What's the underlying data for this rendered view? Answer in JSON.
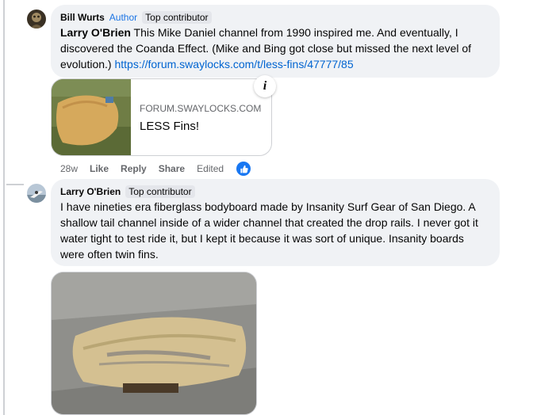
{
  "comment1": {
    "author_name": "Bill Wurts",
    "author_badge": "Author",
    "contributor_badge": "Top contributor",
    "mention": "Larry O'Brien",
    "body": " This Mike Daniel channel from 1990 inspired me. And eventually, I discovered the Coanda Effect. (Mike and Bing got close but missed the next level of evolution.) ",
    "link_text": "https://forum.swaylocks.com/t/less-fins/47777/85",
    "preview": {
      "domain": "FORUM.SWAYLOCKS.COM",
      "title": "LESS Fins!",
      "info_icon": "info-icon"
    },
    "actions": {
      "time": "28w",
      "like": "Like",
      "reply": "Reply",
      "share": "Share",
      "edited": "Edited",
      "reaction_icon": "thumbs-up-icon"
    }
  },
  "comment2": {
    "author_name": "Larry O'Brien",
    "contributor_badge": "Top contributor",
    "body": "I have nineties era fiberglass bodyboard made by Insanity Surf Gear of San Diego. A shallow tail channel inside of a wider channel that created the drop rails. I never got it water tight to test ride it, but I kept it because it was sort of unique. Insanity boards were often twin fins."
  },
  "colors": {
    "bubble": "#f0f2f5",
    "link": "#0064d1",
    "author": "#1b74e4",
    "reaction": "#1877f2"
  }
}
